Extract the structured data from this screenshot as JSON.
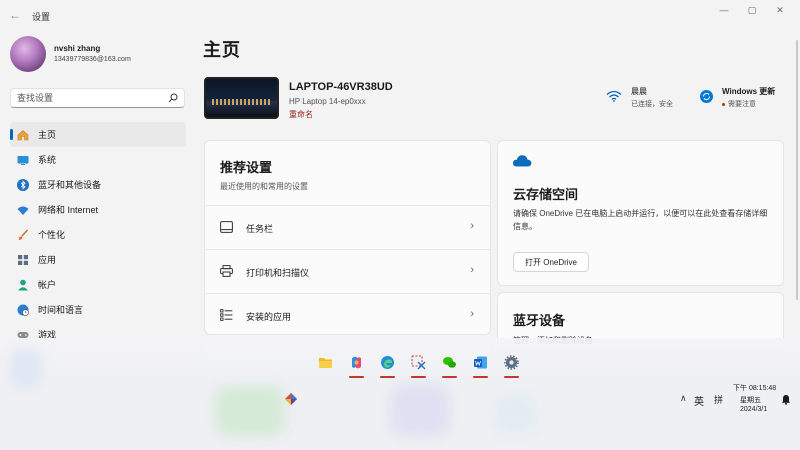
{
  "window": {
    "title": "设置",
    "controls": [
      "—",
      "▢",
      "✕"
    ]
  },
  "profile": {
    "name": "nvshi zhang",
    "email": "13439779836@163.com"
  },
  "search": {
    "placeholder": "查找设置"
  },
  "nav": [
    {
      "label": "主页",
      "icon": "home-icon",
      "active": true
    },
    {
      "label": "系统",
      "icon": "monitor-icon",
      "active": false
    },
    {
      "label": "蓝牙和其他设备",
      "icon": "bluetooth-icon",
      "active": false
    },
    {
      "label": "网络和 Internet",
      "icon": "wifi-icon",
      "active": false
    },
    {
      "label": "个性化",
      "icon": "brush-icon",
      "active": false
    },
    {
      "label": "应用",
      "icon": "apps-icon",
      "active": false
    },
    {
      "label": "帐户",
      "icon": "account-icon",
      "active": false
    },
    {
      "label": "时间和语言",
      "icon": "globe-clock-icon",
      "active": false
    },
    {
      "label": "游戏",
      "icon": "gamepad-icon",
      "active": false
    }
  ],
  "main": {
    "title": "主页",
    "device": {
      "name": "LAPTOP-46VR38UD",
      "model": "HP Laptop 14-ep0xxx",
      "rename": "重命名"
    },
    "wifi": {
      "title": "晨晨",
      "status": "已连接，安全"
    },
    "update": {
      "title": "Windows 更新",
      "status": "需要注意"
    },
    "recommended": {
      "title": "推荐设置",
      "subtitle": "最近使用的和常用的设置",
      "items": [
        {
          "label": "任务栏",
          "icon": "taskbar-icon"
        },
        {
          "label": "打印机和扫描仪",
          "icon": "printer-icon"
        },
        {
          "label": "安装的应用",
          "icon": "app-list-icon"
        }
      ]
    },
    "cloud": {
      "title": "云存储空间",
      "description": "请确保 OneDrive 已在电脑上启动并运行，以便可以在此处查看存储详细信息。",
      "button": "打开 OneDrive"
    },
    "bluetooth": {
      "title": "蓝牙设备",
      "subtitle": "管理、添加和删除设备"
    }
  },
  "taskbar": {
    "apps": [
      "file-explorer-icon",
      "copilot-icon",
      "edge-icon",
      "snipping-tool-icon",
      "wechat-icon",
      "word-icon",
      "settings-icon"
    ],
    "ime_lang": "英",
    "ime_mode": "拼",
    "time": "下午 08:15:48",
    "day": "星期五",
    "date": "2024/3/1"
  },
  "colors": {
    "accent": "#0067c0",
    "alert": "#c42b1c",
    "rename": "#9b1c1c"
  }
}
